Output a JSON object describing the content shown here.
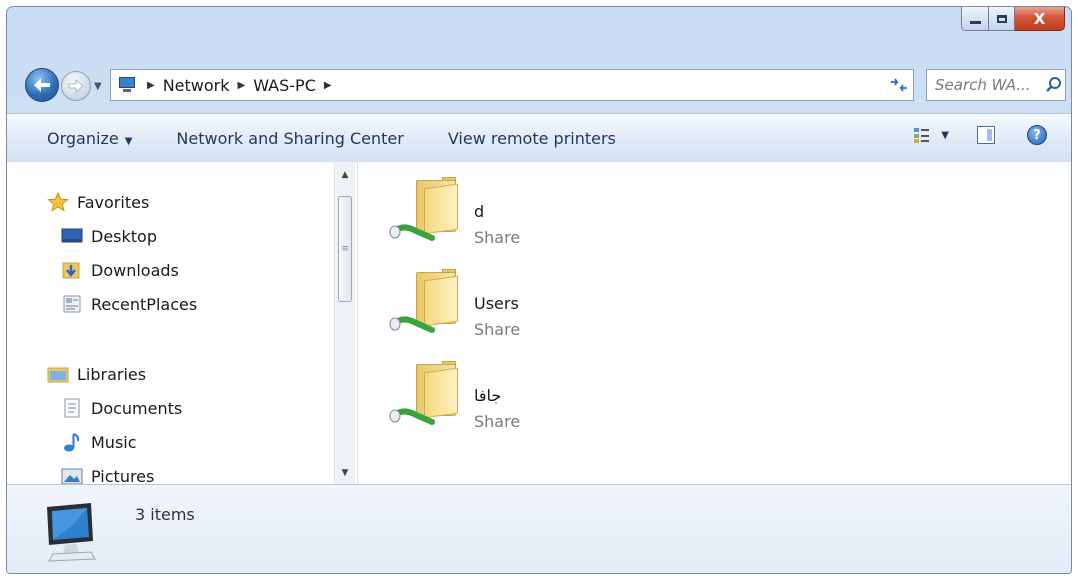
{
  "window": {
    "close_glyph": "X"
  },
  "navbar": {
    "breadcrumbs": [
      "Network",
      "WAS-PC"
    ],
    "search_placeholder": "Search WA..."
  },
  "commandbar": {
    "organize": "Organize",
    "network_sharing": "Network and Sharing Center",
    "remote_printers": "View remote printers",
    "help_glyph": "?"
  },
  "nav_pane": {
    "favorites": {
      "label": "Favorites",
      "items": [
        "Desktop",
        "Downloads",
        "RecentPlaces"
      ]
    },
    "libraries": {
      "label": "Libraries",
      "items": [
        "Documents",
        "Music",
        "Pictures"
      ]
    }
  },
  "content": {
    "items": [
      {
        "name": "d",
        "type": "Share"
      },
      {
        "name": "Users",
        "type": "Share"
      },
      {
        "name": "جافا",
        "type": "Share"
      }
    ]
  },
  "details": {
    "count": "3 items"
  },
  "colors": {
    "accent": "#1e395b",
    "close_button": "#c13a1c",
    "share_pipe": "#3aa33a"
  },
  "icons": [
    "back-arrow-icon",
    "forward-arrow-icon",
    "network-icon",
    "refresh-icon",
    "search-icon",
    "views-icon",
    "preview-pane-icon",
    "help-icon",
    "star-icon",
    "desktop-icon",
    "downloads-icon",
    "recent-places-icon",
    "libraries-icon",
    "documents-icon",
    "music-icon",
    "pictures-icon",
    "shared-folder-icon",
    "computer-icon"
  ]
}
